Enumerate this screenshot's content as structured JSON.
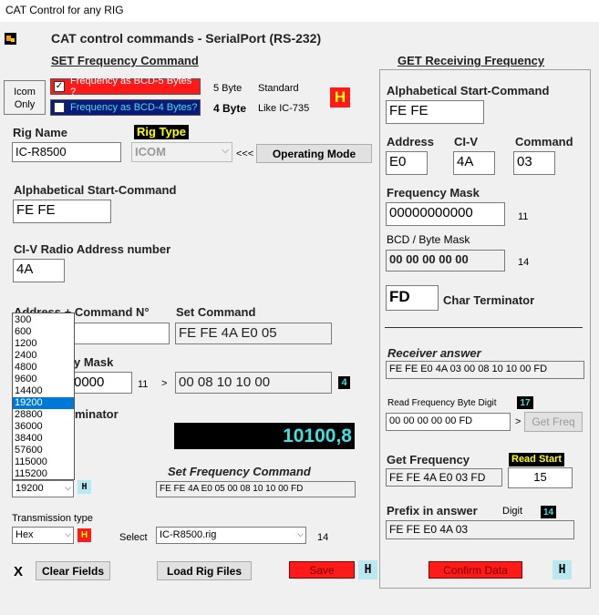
{
  "window": {
    "title": "CAT Control for any RIG"
  },
  "header": {
    "title": "CAT control commands - SerialPort (RS-232)"
  },
  "set_section": {
    "heading": "SET Frequency Command",
    "icom_only": [
      "Icom",
      "Only"
    ],
    "bcd5_label": "Frequency as BCD-5 Bytes ?",
    "bcd4_label": "Frequency as BCD-4 Bytes?",
    "byte5": "5 Byte",
    "standard": "Standard",
    "byte4": "4 Byte",
    "like_ic735": "Like IC-735",
    "h_badge": "H",
    "rig_name_label": "Rig Name",
    "rig_name_value": "IC-R8500",
    "rig_type_label": "Rig Type",
    "rig_type_value": "ICOM",
    "arrows": "<<<",
    "operating_mode_button": "Operating Mode",
    "alpha_start_label": "Alphabetical Start-Command",
    "alpha_start_value": "FE FE",
    "civ_label": "CI-V Radio Address number",
    "civ_value": "4A",
    "addr_cmd_label": "Address + Command N°",
    "set_command_label": "Set Command",
    "set_command_value": "FE FE 4A E0 05",
    "mask_label": "y Mask",
    "mask_value": "0000",
    "mask_len": "11",
    "gt": ">",
    "bcd_value": "00 08 10 10 00",
    "bcd_count": "4",
    "terminator_label": "minator",
    "freq_display": "10100,8",
    "set_freq_cmd_label": "Set Frequency Command",
    "set_freq_cmd_value": "FE FE 4A E0 05 00 08 10 10 00 FD",
    "baud_value": "19200",
    "baud_options": [
      "300",
      "600",
      "1200",
      "2400",
      "4800",
      "9600",
      "14400",
      "19200",
      "28800",
      "36000",
      "38400",
      "57600",
      "115000",
      "115200"
    ],
    "baud_selected": "19200",
    "h_small": "H",
    "transmission_label": "Transmission type",
    "transmission_value": "Hex",
    "select_label": "Select",
    "rig_file_value": "IC-R8500.rig",
    "rig_file_count": "14",
    "x_label": "X",
    "clear_fields_button": "Clear Fields",
    "load_rig_files_button": "Load Rig Files",
    "save_button": "Save",
    "save_h": "H"
  },
  "get_section": {
    "heading": "GET Receiving Frequency",
    "alpha_start_label": "Alphabetical Start-Command",
    "alpha_start_value": "FE FE",
    "address_label": "Address",
    "civ_label": "CI-V",
    "command_label": "Command",
    "address_value": "E0",
    "civ_value": "4A",
    "command_value": "03",
    "freq_mask_label": "Frequency Mask",
    "freq_mask_value": "00000000000",
    "freq_mask_len": "11",
    "bcd_mask_label": "BCD / Byte Mask",
    "bcd_mask_value": "00 00 00 00 00",
    "bcd_mask_len": "14",
    "char_term_value": "FD",
    "char_term_label": "Char Terminator",
    "receiver_answer_label": "Receiver answer",
    "receiver_answer_value": "FE FE E0 4A 03 00 08 10 10 00 FD",
    "read_digit_label": "Read Frequency Byte Digit",
    "read_digit_count": "17",
    "read_digit_value": "00 00 00 00 00 FD",
    "gt": ">",
    "get_freq_button": "Get Freq",
    "get_frequency_label": "Get Frequency",
    "read_start_label": "Read Start",
    "get_frequency_value": "FE FE 4A E0 03 FD",
    "read_start_value": "15",
    "prefix_label": "Prefix in answer",
    "digit_label": "Digit",
    "digit_count": "14",
    "prefix_value": "FE FE E0 4A 03",
    "confirm_button": "Confirm Data",
    "confirm_h": "H"
  },
  "colors": {
    "accent_red": "#ff1a1a",
    "navy": "#0b1a7a",
    "yellow": "#ffff00",
    "cyan_text": "#40e0e0"
  }
}
